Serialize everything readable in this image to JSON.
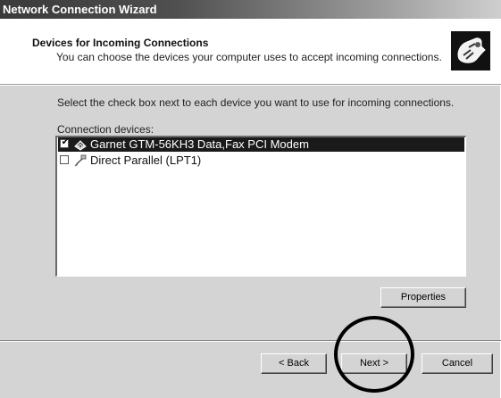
{
  "window": {
    "title": "Network Connection Wizard"
  },
  "header": {
    "title": "Devices for Incoming Connections",
    "subtitle": "You can choose the devices your computer uses to accept incoming connections.",
    "icon": "network-wizard-icon"
  },
  "body": {
    "instruction": "Select the check box next to each device you want to use for incoming connections.",
    "list_label": "Connection devices:",
    "devices": [
      {
        "label": "Garnet GTM-56KH3 Data,Fax PCI Modem",
        "checked": true,
        "selected": true,
        "icon": "modem-icon"
      },
      {
        "label": "Direct Parallel (LPT1)",
        "checked": false,
        "selected": false,
        "icon": "parallel-port-icon"
      }
    ],
    "properties_label": "Properties"
  },
  "footer": {
    "back_label": "< Back",
    "next_label": "Next >",
    "cancel_label": "Cancel"
  },
  "colors": {
    "dialog_background": "#d4d4d4",
    "header_background": "#ffffff",
    "selection_background": "#1a1a1a"
  }
}
